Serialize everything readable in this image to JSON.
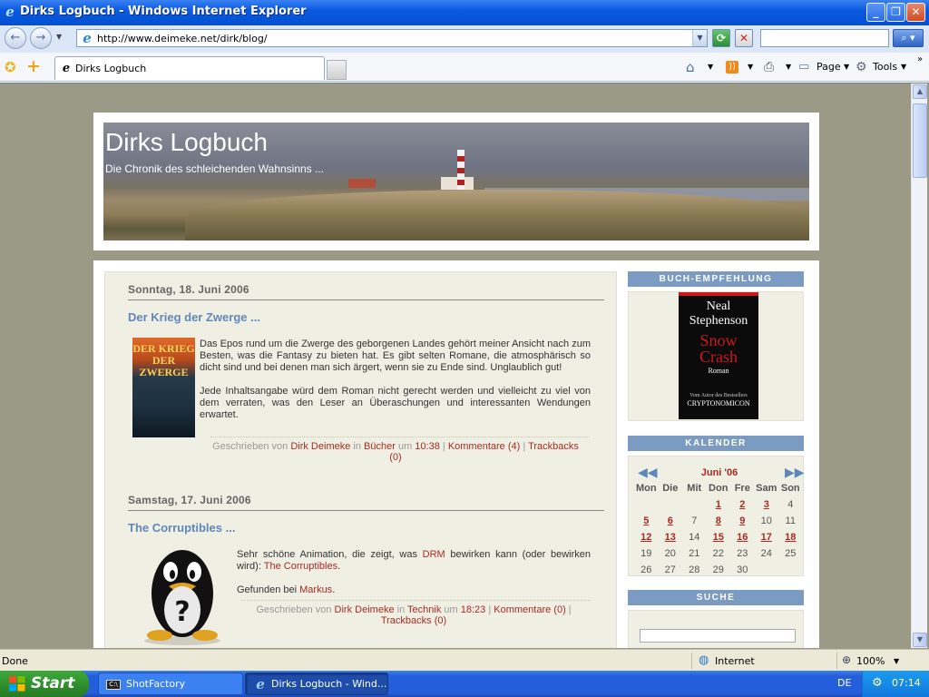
{
  "window": {
    "title": "Dirks Logbuch - Windows Internet Explorer"
  },
  "addressbar": {
    "url": "http://www.deimeke.net/dirk/blog/",
    "search_value": ""
  },
  "tabs": [
    {
      "label": "Dirks Logbuch"
    }
  ],
  "toolbar": {
    "page_label": "Page",
    "tools_label": "Tools"
  },
  "blog": {
    "title": "Dirks Logbuch",
    "subtitle": "Die Chronik des schleichenden Wahnsinns ..."
  },
  "posts": [
    {
      "date": "Sonntag, 18. Juni 2006",
      "title": "Der Krieg der Zwerge ...",
      "cover_text": "DER KRIEG DER ZWERGE",
      "paragraphs": [
        "Das Epos rund um die Zwerge des geborgenen Landes gehört meiner Ansicht nach zum Besten, was die Fantasy zu bieten hat. Es gibt selten Romane, die atmosphärisch so dicht sind und bei denen man sich ärgert, wenn sie zu Ende sind. Unglaublich gut!",
        "Jede Inhaltsangabe würd dem Roman nicht gerecht werden und vielleicht zu viel von dem verraten, was den Leser an Überaschungen und interessanten Wendungen erwartet."
      ],
      "meta": {
        "written_by": "Geschrieben von",
        "author": "Dirk Deimeke",
        "in": "in",
        "category": "Bücher",
        "at": "um",
        "time": "10:38",
        "comments": "Kommentare (4)",
        "trackbacks": "Trackbacks (0)"
      }
    },
    {
      "date": "Samstag, 17. Juni 2006",
      "title": "The Corruptibles ...",
      "text_before_drm": "Sehr schöne Animation, die zeigt, was",
      "drm_link": "DRM",
      "text_after_drm": "bewirken kann (oder bewirken wird):",
      "corruptibles_link": "The Corruptibles",
      "found_prefix": "Gefunden bei",
      "found_link": "Markus",
      "meta": {
        "written_by": "Geschrieben von",
        "author": "Dirk Deimeke",
        "in": "in",
        "category": "Technik",
        "at": "um",
        "time": "18:23",
        "comments": "Kommentare (0)",
        "trackbacks": "Trackbacks (0)"
      }
    }
  ],
  "sidebar": {
    "book_heading": "BUCH-EMPFEHLUNG",
    "book": {
      "author_line1": "Neal",
      "author_line2": "Stephenson",
      "title_line1": "Snow",
      "title_line2": "Crash",
      "genre": "Roman",
      "tagline": "Vom Autor des Bestsellers",
      "other_title": "CRYPTONOMICON"
    },
    "calendar_heading": "KALENDER",
    "calendar": {
      "month": "Juni '06",
      "weekdays": [
        "Mon",
        "Die",
        "Mit",
        "Don",
        "Fre",
        "Sam",
        "Son"
      ],
      "weeks": [
        [
          "",
          "",
          "",
          "1",
          "2",
          "3",
          "4"
        ],
        [
          "5",
          "6",
          "7",
          "8",
          "9",
          "10",
          "11"
        ],
        [
          "12",
          "13",
          "14",
          "15",
          "16",
          "17",
          "18"
        ],
        [
          "19",
          "20",
          "21",
          "22",
          "23",
          "24",
          "25"
        ],
        [
          "26",
          "27",
          "28",
          "29",
          "30",
          "",
          ""
        ]
      ],
      "linked_days": [
        "1",
        "2",
        "3",
        "5",
        "6",
        "8",
        "9",
        "12",
        "13",
        "15",
        "16",
        "17",
        "18"
      ]
    },
    "search_heading": "SUCHE"
  },
  "statusbar": {
    "status": "Done",
    "zone": "Internet",
    "zoom": "100%"
  },
  "taskbar": {
    "start_label": "Start",
    "tasks": [
      {
        "label": "ShotFactory"
      },
      {
        "label": "Dirks Logbuch - Wind..."
      }
    ],
    "language": "DE",
    "clock": "07:14"
  }
}
